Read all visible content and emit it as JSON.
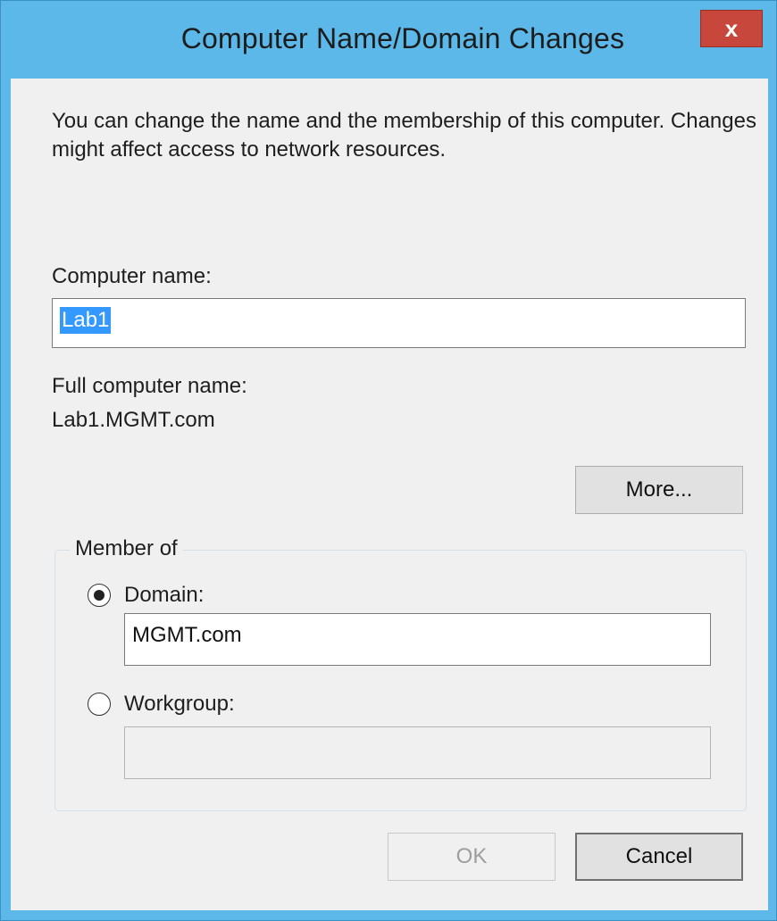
{
  "window": {
    "title": "Computer Name/Domain Changes",
    "close_glyph": "x"
  },
  "description": "You can change the name and the membership of this computer. Changes might affect access to network resources.",
  "computer_name": {
    "label": "Computer name:",
    "value": "Lab1"
  },
  "full_name": {
    "label": "Full computer name:",
    "value": "Lab1.MGMT.com"
  },
  "more_button": "More...",
  "member_of": {
    "legend": "Member of",
    "domain": {
      "label": "Domain:",
      "value": "MGMT.com",
      "selected": true
    },
    "workgroup": {
      "label": "Workgroup:",
      "value": "",
      "selected": false
    }
  },
  "buttons": {
    "ok": "OK",
    "cancel": "Cancel"
  },
  "colors": {
    "frame": "#5cb8e8",
    "close": "#c7473c",
    "selection": "#3399ff"
  },
  "icons": {
    "close": "close-icon",
    "radio_selected": "radio-selected-icon",
    "radio_unselected": "radio-unselected-icon"
  }
}
